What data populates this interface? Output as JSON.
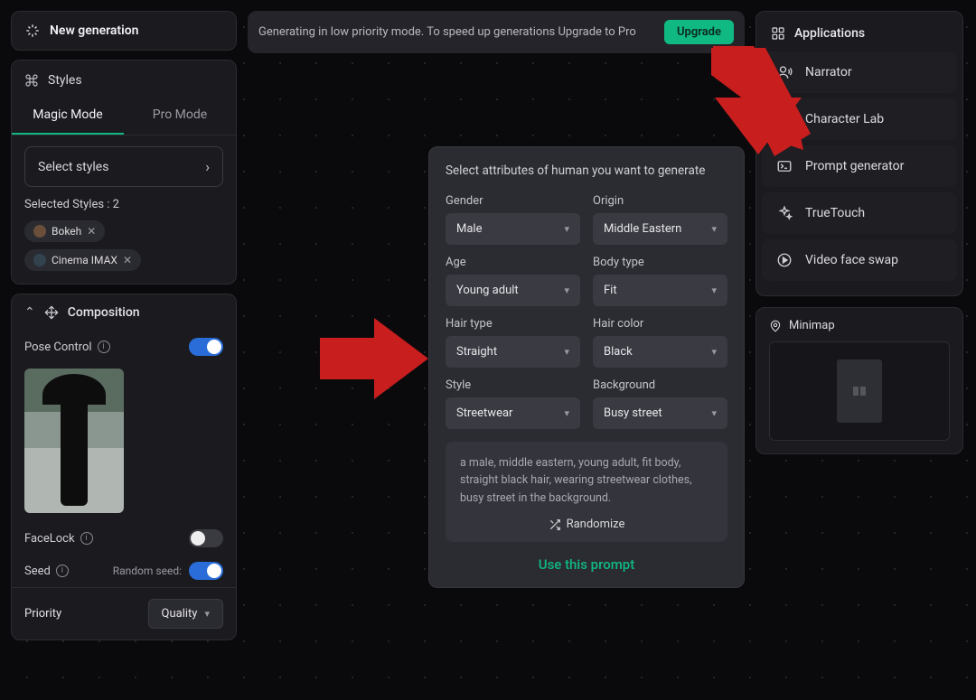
{
  "banner": {
    "text": "Generating in low priority mode. To speed up generations Upgrade to Pro",
    "button": "Upgrade"
  },
  "left": {
    "title": "New generation",
    "styles_label": "Styles",
    "tabs": {
      "magic": "Magic Mode",
      "pro": "Pro Mode"
    },
    "select_styles": "Select styles",
    "selected_count": "Selected Styles : 2",
    "chips": {
      "bokeh": "Bokeh",
      "cinema": "Cinema IMAX"
    },
    "composition": "Composition",
    "pose_control": "Pose Control",
    "facelock": "FaceLock",
    "seed": "Seed",
    "random_seed": "Random seed:",
    "priority_label": "Priority",
    "priority_value": "Quality"
  },
  "prompt_panel": {
    "title": "Select attributes of human you want to generate",
    "fields": {
      "gender": {
        "label": "Gender",
        "value": "Male"
      },
      "origin": {
        "label": "Origin",
        "value": "Middle Eastern"
      },
      "age": {
        "label": "Age",
        "value": "Young adult"
      },
      "body": {
        "label": "Body type",
        "value": "Fit"
      },
      "hairtype": {
        "label": "Hair type",
        "value": "Straight"
      },
      "haircolor": {
        "label": "Hair color",
        "value": "Black"
      },
      "style": {
        "label": "Style",
        "value": "Streetwear"
      },
      "background": {
        "label": "Background",
        "value": "Busy street"
      }
    },
    "output": "a male, middle eastern, young adult, fit body, straight black hair, wearing streetwear clothes, busy street in the background.",
    "randomize": "Randomize",
    "use": "Use this prompt"
  },
  "right": {
    "apps_title": "Applications",
    "items": {
      "narrator": "Narrator",
      "charlab": "Character Lab",
      "promptgen": "Prompt generator",
      "truetouch": "TrueTouch",
      "faceswap": "Video face swap"
    },
    "minimap": "Minimap"
  }
}
